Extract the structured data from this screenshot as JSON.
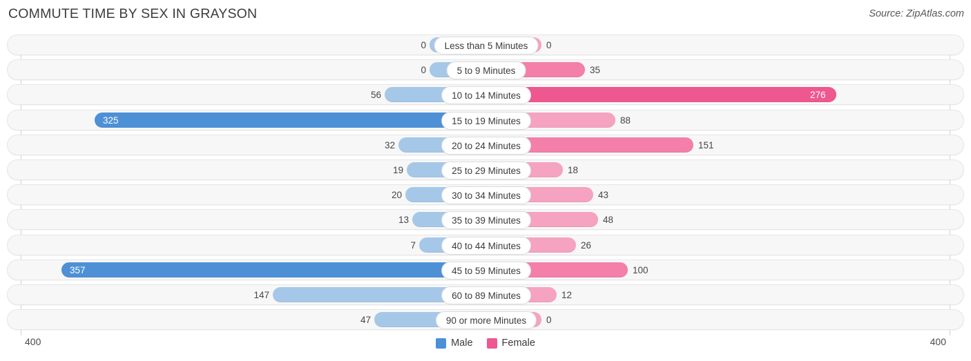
{
  "header": {
    "title": "COMMUTE TIME BY SEX IN GRAYSON",
    "source": "Source: ZipAtlas.com"
  },
  "axis": {
    "left_tick": "400",
    "right_tick": "400",
    "max": 400
  },
  "legend": {
    "male_label": "Male",
    "female_label": "Female",
    "male_color": "#4e90d6",
    "female_color": "#ee5790"
  },
  "colors": {
    "male_light": "#a6c8e8",
    "male_accent": "#4e90d6",
    "female_light": "#f5a3c0",
    "female_mid": "#f47fa9",
    "female_accent": "#ee5790",
    "track": "#f7f7f7",
    "track_border": "#e6e6e6"
  },
  "chart_data": {
    "type": "bar",
    "title": "COMMUTE TIME BY SEX IN GRAYSON",
    "subtitle": "Source: ZipAtlas.com",
    "orientation": "horizontal-diverging",
    "xlabel": "",
    "ylabel": "",
    "xlim": [
      400,
      400
    ],
    "grid": false,
    "legend_position": "bottom-center",
    "categories": [
      "Less than 5 Minutes",
      "5 to 9 Minutes",
      "10 to 14 Minutes",
      "15 to 19 Minutes",
      "20 to 24 Minutes",
      "25 to 29 Minutes",
      "30 to 34 Minutes",
      "35 to 39 Minutes",
      "40 to 44 Minutes",
      "45 to 59 Minutes",
      "60 to 89 Minutes",
      "90 or more Minutes"
    ],
    "series": [
      {
        "name": "Male",
        "values": [
          0,
          0,
          56,
          325,
          32,
          19,
          20,
          13,
          7,
          357,
          147,
          47
        ]
      },
      {
        "name": "Female",
        "values": [
          0,
          35,
          276,
          88,
          151,
          18,
          43,
          48,
          26,
          100,
          12,
          0
        ]
      }
    ]
  },
  "rows": [
    {
      "label": "Less than 5 Minutes",
      "male": "0",
      "female": "0",
      "male_w": 80,
      "female_w": 80,
      "male_style": "",
      "female_style": "",
      "male_inside": false,
      "female_inside": false
    },
    {
      "label": "5 to 9 Minutes",
      "male": "0",
      "female": "35",
      "male_w": 80,
      "female_w": 143,
      "male_style": "",
      "female_style": "mid",
      "male_inside": false,
      "female_inside": false
    },
    {
      "label": "10 to 14 Minutes",
      "male": "56",
      "female": "276",
      "male_w": 145,
      "female_w": 507,
      "male_style": "",
      "female_style": "accent",
      "male_inside": false,
      "female_inside": true
    },
    {
      "label": "15 to 19 Minutes",
      "male": "325",
      "female": "88",
      "male_w": 565,
      "female_w": 187,
      "male_style": "accent",
      "female_style": "",
      "male_inside": true,
      "female_inside": false
    },
    {
      "label": "20 to 24 Minutes",
      "male": "32",
      "female": "151",
      "male_w": 125,
      "female_w": 300,
      "male_style": "",
      "female_style": "mid",
      "male_inside": false,
      "female_inside": false
    },
    {
      "label": "25 to 29 Minutes",
      "male": "19",
      "female": "18",
      "male_w": 113,
      "female_w": 111,
      "male_style": "",
      "female_style": "",
      "male_inside": false,
      "female_inside": false
    },
    {
      "label": "30 to 34 Minutes",
      "male": "20",
      "female": "43",
      "male_w": 115,
      "female_w": 155,
      "male_style": "",
      "female_style": "",
      "male_inside": false,
      "female_inside": false
    },
    {
      "label": "35 to 39 Minutes",
      "male": "13",
      "female": "48",
      "male_w": 105,
      "female_w": 162,
      "male_style": "",
      "female_style": "",
      "male_inside": false,
      "female_inside": false
    },
    {
      "label": "40 to 44 Minutes",
      "male": "7",
      "female": "26",
      "male_w": 95,
      "female_w": 130,
      "male_style": "",
      "female_style": "",
      "male_inside": false,
      "female_inside": false
    },
    {
      "label": "45 to 59 Minutes",
      "male": "357",
      "female": "100",
      "male_w": 613,
      "female_w": 205,
      "male_style": "accent",
      "female_style": "mid",
      "male_inside": true,
      "female_inside": false
    },
    {
      "label": "60 to 89 Minutes",
      "male": "147",
      "female": "12",
      "male_w": 307,
      "female_w": 102,
      "male_style": "",
      "female_style": "",
      "male_inside": false,
      "female_inside": false
    },
    {
      "label": "90 or more Minutes",
      "male": "47",
      "female": "0",
      "male_w": 160,
      "female_w": 80,
      "male_style": "",
      "female_style": "",
      "male_inside": false,
      "female_inside": false
    }
  ]
}
